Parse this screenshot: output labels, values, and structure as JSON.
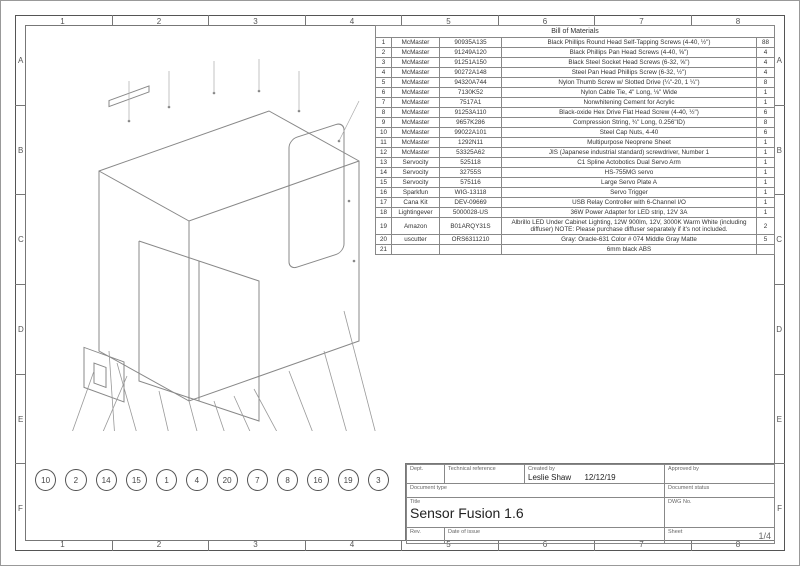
{
  "grid": {
    "cols": [
      "1",
      "2",
      "3",
      "4",
      "5",
      "6",
      "7",
      "8"
    ],
    "rows": [
      "A",
      "B",
      "C",
      "D",
      "E",
      "F"
    ]
  },
  "balloons": [
    "10",
    "2",
    "14",
    "15",
    "1",
    "4",
    "20",
    "7",
    "8",
    "16",
    "19",
    "3"
  ],
  "bom": {
    "title": "Bill of Materials",
    "rows": [
      {
        "n": "1",
        "sup": "McMaster",
        "part": "90935A135",
        "desc": "Black Phillips Round Head Self-Tapping Screws (4-40, ½\")",
        "qty": "88"
      },
      {
        "n": "2",
        "sup": "McMaster",
        "part": "91249A120",
        "desc": "Black Phillips Pan Head Screws (4-40, ⅝\")",
        "qty": "4"
      },
      {
        "n": "3",
        "sup": "McMaster",
        "part": "91251A150",
        "desc": "Black Steel Socket Head Screws (6-32, ⅝\")",
        "qty": "4"
      },
      {
        "n": "4",
        "sup": "McMaster",
        "part": "90272A148",
        "desc": "Steel Pan Head Phillips Screw (6-32, ½\")",
        "qty": "4"
      },
      {
        "n": "5",
        "sup": "McMaster",
        "part": "94320A744",
        "desc": "Nylon Thumb Screw w/ Slotted Drive (¼\"-20, 1 ¼\")",
        "qty": "8"
      },
      {
        "n": "6",
        "sup": "McMaster",
        "part": "7130K52",
        "desc": "Nylon Cable Tie, 4\" Long, ⅛\" Wide",
        "qty": "1"
      },
      {
        "n": "7",
        "sup": "McMaster",
        "part": "7517A1",
        "desc": "Nonwhitening Cement for Acrylic",
        "qty": "1"
      },
      {
        "n": "8",
        "sup": "McMaster",
        "part": "91253A110",
        "desc": "Black-oxide Hex Drive Flat Head Screw (4-40, ½\")",
        "qty": "6"
      },
      {
        "n": "9",
        "sup": "McMaster",
        "part": "9657K286",
        "desc": "Compression String, ¾\" Long, 0.256\"ID)",
        "qty": "8"
      },
      {
        "n": "10",
        "sup": "McMaster",
        "part": "99022A101",
        "desc": "Steel Cap Nuts, 4-40",
        "qty": "6"
      },
      {
        "n": "11",
        "sup": "McMaster",
        "part": "1292N11",
        "desc": "Multipurpose Neoprene Sheet",
        "qty": "1"
      },
      {
        "n": "12",
        "sup": "McMaster",
        "part": "53325A62",
        "desc": "JIS (Japanese industrial standard) screwdriver, Number 1",
        "qty": "1"
      },
      {
        "n": "13",
        "sup": "Servocity",
        "part": "525118",
        "desc": "C1 Spline Actobotics Dual Servo Arm",
        "qty": "1"
      },
      {
        "n": "14",
        "sup": "Servocity",
        "part": "32755S",
        "desc": "HS-755MG servo",
        "qty": "1"
      },
      {
        "n": "15",
        "sup": "Servocity",
        "part": "575116",
        "desc": "Large Servo Plate A",
        "qty": "1"
      },
      {
        "n": "16",
        "sup": "Sparkfun",
        "part": "WIG-13118",
        "desc": "Servo Trigger",
        "qty": "1"
      },
      {
        "n": "17",
        "sup": "Cana Kit",
        "part": "DEV-09669",
        "desc": "USB Relay Controller with 6-Channel I/O",
        "qty": "1"
      },
      {
        "n": "18",
        "sup": "Lightingever",
        "part": "5000028-US",
        "desc": "36W Power Adapter for LED strip, 12V 3A",
        "qty": "1"
      },
      {
        "n": "19",
        "sup": "Amazon",
        "part": "B01ARQY31S",
        "desc": "Albrillo LED Under Cabinet Lighting, 12W 900lm, 12V, 3000K Warm White (including diffuser) NOTE: Please purchase diffuser separately if it's not included.",
        "qty": "2"
      },
      {
        "n": "20",
        "sup": "uscutter",
        "part": "ORS6311210",
        "desc": "Gray: Oracle-631 Color # 074 Middle Gray Matte",
        "qty": "5"
      },
      {
        "n": "21",
        "sup": "",
        "part": "",
        "desc": "6mm black ABS",
        "qty": ""
      }
    ]
  },
  "titleblock": {
    "labels": {
      "dept": "Dept.",
      "techref": "Technical reference",
      "created": "Created by",
      "approved": "Approved by",
      "doctype": "Document type",
      "docstatus": "Document status",
      "title": "Title",
      "dwg": "DWG No.",
      "rev": "Rev.",
      "doi": "Date of issue",
      "sheet": "Sheet"
    },
    "created_by": "Leslie Shaw",
    "created_date": "12/12/19",
    "title": "Sensor Fusion 1.6",
    "sheet": "1/4"
  }
}
